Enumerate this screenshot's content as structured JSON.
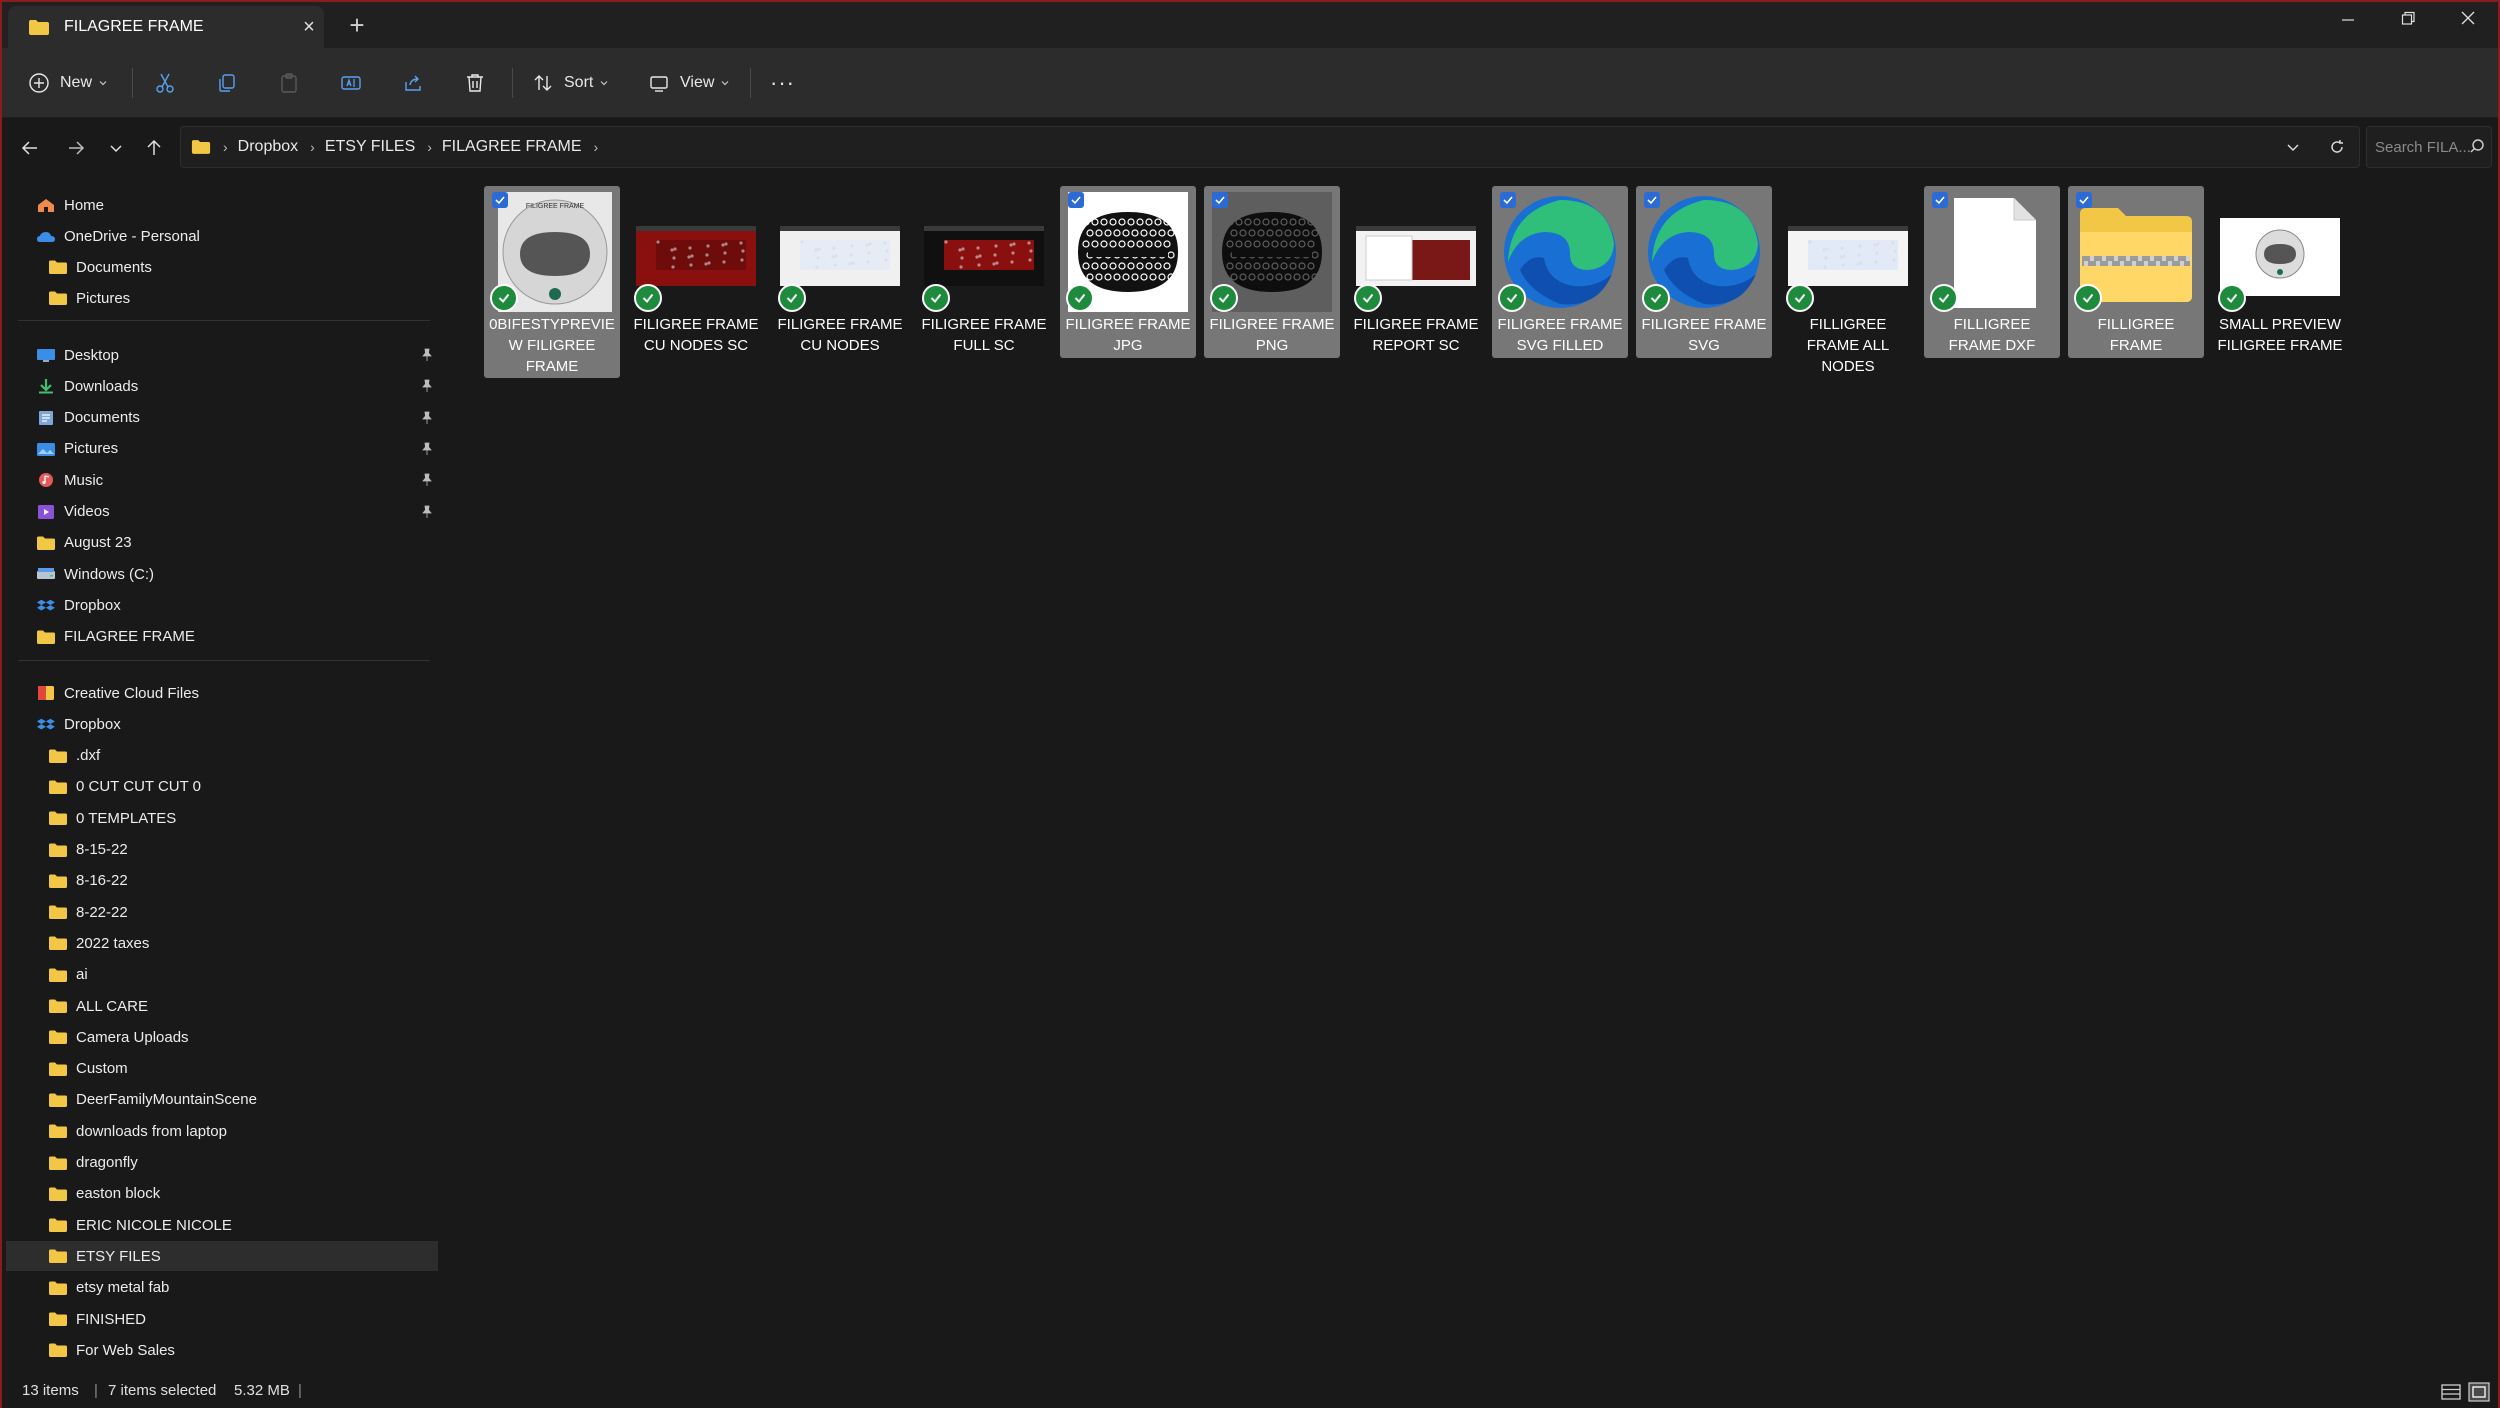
{
  "window": {
    "tab_title": "FILAGREE FRAME",
    "new_tab": "+",
    "close_tab": "×"
  },
  "toolbar": {
    "new_label": "New",
    "sort_label": "Sort",
    "view_label": "View",
    "more_label": "···"
  },
  "address": {
    "crumbs": [
      "Dropbox",
      "ETSY FILES",
      "FILAGREE FRAME"
    ],
    "search_placeholder": "Search FILA..."
  },
  "sidebar": {
    "top_items": [
      {
        "label": "Home",
        "icon": "home-icon"
      },
      {
        "label": "OneDrive - Personal",
        "icon": "onedrive-icon"
      },
      {
        "label": "Documents",
        "icon": "folder-icon"
      },
      {
        "label": "Pictures",
        "icon": "folder-icon"
      }
    ],
    "quick_access": [
      {
        "label": "Desktop",
        "icon": "desktop-icon",
        "pinned": true
      },
      {
        "label": "Downloads",
        "icon": "downloads-icon",
        "pinned": true
      },
      {
        "label": "Documents",
        "icon": "documents-icon",
        "pinned": true
      },
      {
        "label": "Pictures",
        "icon": "pictures-icon",
        "pinned": true
      },
      {
        "label": "Music",
        "icon": "music-icon",
        "pinned": true
      },
      {
        "label": "Videos",
        "icon": "videos-icon",
        "pinned": true
      },
      {
        "label": "August 23",
        "icon": "folder-icon",
        "pinned": false
      },
      {
        "label": "Windows (C:)",
        "icon": "drive-icon",
        "pinned": false
      },
      {
        "label": "Dropbox",
        "icon": "dropbox-icon",
        "pinned": false
      },
      {
        "label": "FILAGREE FRAME",
        "icon": "folder-icon",
        "pinned": false
      }
    ],
    "tree": [
      {
        "label": "Creative Cloud Files",
        "icon": "creative-cloud-icon",
        "level": 0
      },
      {
        "label": "Dropbox",
        "icon": "dropbox-icon",
        "level": 0
      },
      {
        "label": ".dxf",
        "icon": "folder-icon",
        "level": 1
      },
      {
        "label": "0 CUT CUT CUT 0",
        "icon": "folder-icon",
        "level": 1
      },
      {
        "label": "0 TEMPLATES",
        "icon": "folder-icon",
        "level": 1
      },
      {
        "label": "8-15-22",
        "icon": "folder-icon",
        "level": 1
      },
      {
        "label": "8-16-22",
        "icon": "folder-icon",
        "level": 1
      },
      {
        "label": "8-22-22",
        "icon": "folder-icon",
        "level": 1
      },
      {
        "label": "2022 taxes",
        "icon": "folder-icon",
        "level": 1
      },
      {
        "label": "ai",
        "icon": "folder-icon",
        "level": 1
      },
      {
        "label": "ALL CARE",
        "icon": "folder-icon",
        "level": 1
      },
      {
        "label": "Camera Uploads",
        "icon": "folder-icon",
        "level": 1
      },
      {
        "label": "Custom",
        "icon": "folder-icon",
        "level": 1
      },
      {
        "label": "DeerFamilyMountainScene",
        "icon": "folder-icon",
        "level": 1
      },
      {
        "label": "downloads from laptop",
        "icon": "folder-icon",
        "level": 1
      },
      {
        "label": "dragonfly",
        "icon": "folder-icon",
        "level": 1
      },
      {
        "label": "easton block",
        "icon": "folder-icon",
        "level": 1
      },
      {
        "label": "ERIC NICOLE NICOLE",
        "icon": "folder-icon",
        "level": 1
      },
      {
        "label": "ETSY FILES",
        "icon": "folder-icon",
        "level": 1,
        "selected": true
      },
      {
        "label": "etsy metal fab",
        "icon": "folder-icon",
        "level": 1
      },
      {
        "label": "FINISHED",
        "icon": "folder-icon",
        "level": 1
      },
      {
        "label": "For Web Sales",
        "icon": "folder-icon",
        "level": 1
      }
    ]
  },
  "files": [
    {
      "name": "0BIFESTYPREVIEW FILIGREE FRAME",
      "selected": true,
      "thumb": "preview-circle",
      "thumb_title": "FILIGREE FRAME"
    },
    {
      "name": "FILIGREE FRAME CU NODES SC",
      "selected": false,
      "thumb": "screenshot-red"
    },
    {
      "name": "FILIGREE FRAME CU NODES",
      "selected": false,
      "thumb": "screenshot-white"
    },
    {
      "name": "FILIGREE FRAME FULL SC",
      "selected": false,
      "thumb": "screenshot-dark"
    },
    {
      "name": "FILIGREE FRAME JPG",
      "selected": true,
      "thumb": "filigree-white"
    },
    {
      "name": "FILIGREE FRAME PNG",
      "selected": true,
      "thumb": "filigree-gray"
    },
    {
      "name": "FILIGREE FRAME REPORT SC",
      "selected": false,
      "thumb": "screenshot-report"
    },
    {
      "name": "FILIGREE FRAME SVG FILLED",
      "selected": true,
      "thumb": "edge"
    },
    {
      "name": "FILIGREE FRAME SVG",
      "selected": true,
      "thumb": "edge"
    },
    {
      "name": "FILLIGREE FRAME ALL NODES",
      "selected": false,
      "thumb": "screenshot-nodes"
    },
    {
      "name": "FILLIGREE FRAME DXF",
      "selected": true,
      "thumb": "blank-doc"
    },
    {
      "name": "FILLIGREE FRAME",
      "selected": true,
      "thumb": "zip-folder"
    },
    {
      "name": "SMALL PREVIEW FILIGREE FRAME",
      "selected": false,
      "thumb": "preview-small"
    }
  ],
  "status": {
    "count": "13 items",
    "selected": "7 items selected",
    "size": "5.32 MB"
  },
  "colors": {
    "window_border": "#8a1c1c",
    "selection": "#777777",
    "sync_badge": "#1e8a3c",
    "folder": "#f3c746",
    "checkbox": "#2a6bd6"
  }
}
